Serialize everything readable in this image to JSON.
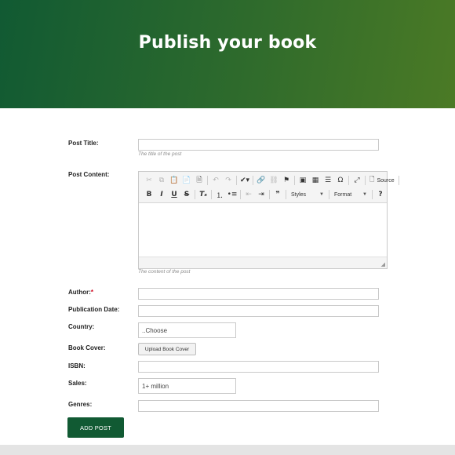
{
  "header": {
    "title": "Publish your book"
  },
  "form": {
    "post_title": {
      "label": "Post Title:",
      "value": "",
      "help": "The title of the post"
    },
    "post_content": {
      "label": "Post Content:",
      "help": "The content of the post",
      "toolbar": {
        "source_label": "Source",
        "styles_label": "Styles",
        "format_label": "Format",
        "help_symbol": "?"
      }
    },
    "author": {
      "label": "Author:",
      "required_mark": "*",
      "value": ""
    },
    "publication_date": {
      "label": "Publication Date:",
      "value": ""
    },
    "country": {
      "label": "Country:",
      "selected": "..Choose"
    },
    "book_cover": {
      "label": "Book Cover:",
      "button_label": "Upload Book Cover"
    },
    "isbn": {
      "label": "ISBN:",
      "value": ""
    },
    "sales": {
      "label": "Sales:",
      "selected": "1+ million"
    },
    "genres": {
      "label": "Genres:",
      "value": ""
    },
    "submit_label": "ADD POST"
  },
  "colors": {
    "accent": "#115a33",
    "hero_end": "#4b7a25",
    "required": "#d0021b"
  }
}
